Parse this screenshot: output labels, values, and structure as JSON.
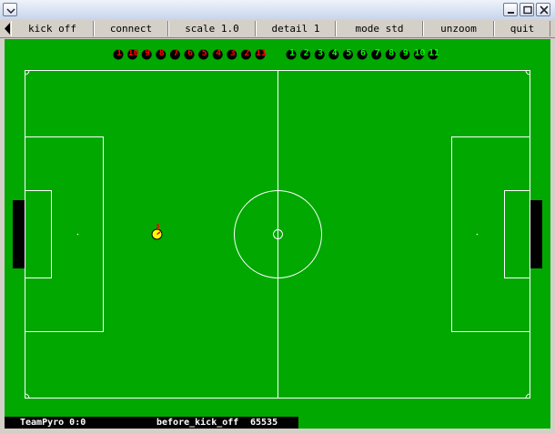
{
  "window": {
    "controls": [
      "minimize-icon",
      "maximize-icon",
      "close-icon"
    ]
  },
  "menu": {
    "items": [
      "kick off",
      "connect",
      "scale 1.0",
      "detail 1",
      "mode std",
      "unzoom",
      "quit"
    ]
  },
  "colors": {
    "pitch": "#00a800",
    "lines": "#ffffff",
    "team_left": "#ff0000",
    "team_right": "#00ff00",
    "goal": "#000000",
    "ball": "#ffff00"
  },
  "teams": {
    "left": {
      "numbers": [
        "1",
        "10",
        "9",
        "8",
        "7",
        "6",
        "5",
        "4",
        "3",
        "2",
        "11"
      ]
    },
    "right": {
      "numbers": [
        "1",
        "2",
        "3",
        "4",
        "5",
        "6",
        "7",
        "8",
        "9",
        "10",
        "11"
      ]
    }
  },
  "status": {
    "score": "TeamPyro 0:0",
    "play_mode": "before_kick_off",
    "time": "65535"
  }
}
